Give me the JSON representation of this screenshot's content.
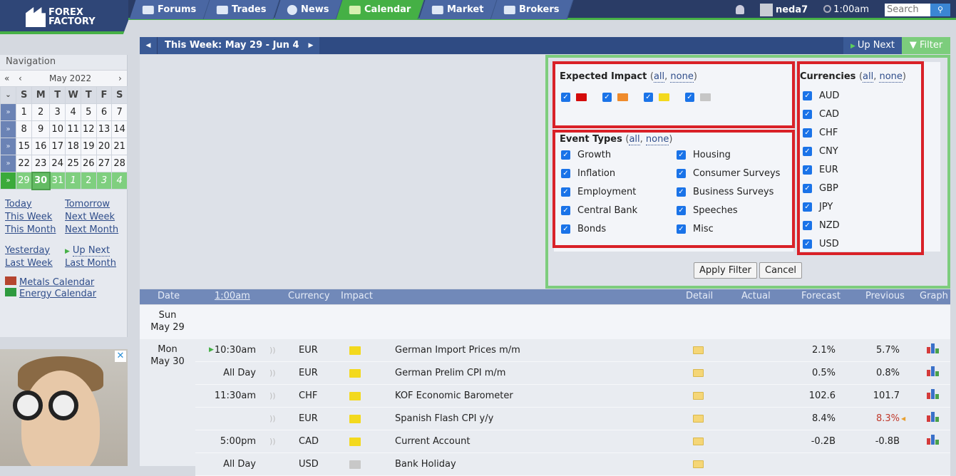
{
  "header": {
    "logo_text": [
      "FOREX",
      "FACTORY"
    ],
    "tabs": [
      {
        "label": "Forums",
        "icon": "forums-icon"
      },
      {
        "label": "Trades",
        "icon": "trades-icon"
      },
      {
        "label": "News",
        "icon": "globe-icon"
      },
      {
        "label": "Calendar",
        "icon": "calendar-icon",
        "active": true
      },
      {
        "label": "Market",
        "icon": "market-icon"
      },
      {
        "label": "Brokers",
        "icon": "brokers-icon"
      }
    ],
    "username": "neda7",
    "time": "1:00am",
    "search_placeholder": "Search"
  },
  "weekbar": {
    "title": "This Week: May 29 - Jun 4",
    "up_next": "Up Next",
    "filter": "Filter"
  },
  "sidebar": {
    "title": "Navigation",
    "month": "May 2022",
    "weekdays": [
      "S",
      "M",
      "T",
      "W",
      "T",
      "F",
      "S"
    ],
    "weeks": [
      [
        "1",
        "2",
        "3",
        "4",
        "5",
        "6",
        "7"
      ],
      [
        "8",
        "9",
        "10",
        "11",
        "12",
        "13",
        "14"
      ],
      [
        "15",
        "16",
        "17",
        "18",
        "19",
        "20",
        "21"
      ],
      [
        "22",
        "23",
        "24",
        "25",
        "26",
        "27",
        "28"
      ],
      [
        "29",
        "30",
        "31",
        "1",
        "2",
        "3",
        "4"
      ]
    ],
    "links": [
      "Today",
      "Tomorrow",
      "This Week",
      "Next Week",
      "This Month",
      "Next Month"
    ],
    "links2": [
      "Yesterday",
      "Up Next",
      "Last Week",
      "Last Month"
    ],
    "metals": "Metals Calendar",
    "energy": "Energy Calendar"
  },
  "filter": {
    "impact_title": "Expected Impact",
    "all": "all",
    "none": "none",
    "impact_colors": [
      "#d40b0b",
      "#ef8b2c",
      "#f3d91e",
      "#c6c6c6"
    ],
    "event_title": "Event Types",
    "events_left": [
      "Growth",
      "Inflation",
      "Employment",
      "Central Bank",
      "Bonds"
    ],
    "events_right": [
      "Housing",
      "Consumer Surveys",
      "Business Surveys",
      "Speeches",
      "Misc"
    ],
    "currency_title": "Currencies",
    "currencies": [
      "AUD",
      "CAD",
      "CHF",
      "CNY",
      "EUR",
      "GBP",
      "JPY",
      "NZD",
      "USD"
    ],
    "apply": "Apply Filter",
    "cancel": "Cancel"
  },
  "table": {
    "headers": {
      "date": "Date",
      "time": "1:00am",
      "currency": "Currency",
      "impact": "Impact",
      "detail": "Detail",
      "actual": "Actual",
      "forecast": "Forecast",
      "previous": "Previous",
      "graph": "Graph"
    },
    "days": [
      {
        "day": "Sun",
        "date": "May 29"
      },
      {
        "day": "Mon",
        "date": "May 30"
      }
    ],
    "rows": [
      {
        "time": "10:30am",
        "currency": "EUR",
        "impact": "yellow",
        "event": "German Import Prices m/m",
        "forecast": "2.1%",
        "previous": "5.7%"
      },
      {
        "time": "All Day",
        "currency": "EUR",
        "impact": "yellow",
        "event": "German Prelim CPI m/m",
        "forecast": "0.5%",
        "previous": "0.8%"
      },
      {
        "time": "11:30am",
        "currency": "CHF",
        "impact": "yellow",
        "event": "KOF Economic Barometer",
        "forecast": "102.6",
        "previous": "101.7"
      },
      {
        "time": "",
        "currency": "EUR",
        "impact": "yellow",
        "event": "Spanish Flash CPI y/y",
        "forecast": "8.4%",
        "previous": "8.3%",
        "previous_revised": true
      },
      {
        "time": "5:00pm",
        "currency": "CAD",
        "impact": "yellow",
        "event": "Current Account",
        "forecast": "-0.2B",
        "previous": "-0.8B"
      },
      {
        "time": "All Day",
        "currency": "USD",
        "impact": "gray",
        "event": "Bank Holiday",
        "forecast": "",
        "previous": ""
      }
    ]
  }
}
